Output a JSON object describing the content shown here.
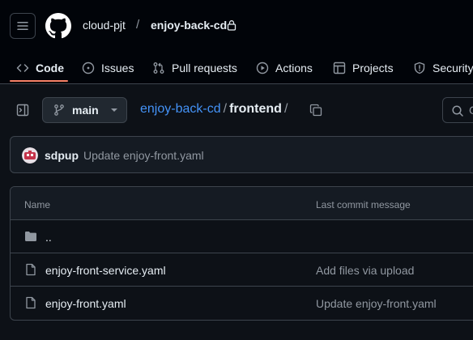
{
  "header": {
    "owner": "cloud-pjt",
    "separator": "/",
    "repo": "enjoy-back-cd"
  },
  "tabs": [
    {
      "label": "Code",
      "icon": "code-icon",
      "active": true
    },
    {
      "label": "Issues",
      "icon": "issue-opened-icon"
    },
    {
      "label": "Pull requests",
      "icon": "git-pull-request-icon"
    },
    {
      "label": "Actions",
      "icon": "play-icon"
    },
    {
      "label": "Projects",
      "icon": "table-icon"
    },
    {
      "label": "Security",
      "icon": "shield-icon"
    }
  ],
  "toolbar": {
    "branch": "main",
    "path_repo": "enjoy-back-cd",
    "path_sep": "/",
    "path_dir": "frontend",
    "path_trailing": "/"
  },
  "commit": {
    "user": "sdpup",
    "message": "Update enjoy-front.yaml"
  },
  "table": {
    "headers": {
      "name": "Name",
      "commit": "Last commit message"
    },
    "rows": [
      {
        "name": "..",
        "type": "folder",
        "message": ""
      },
      {
        "name": "enjoy-front-service.yaml",
        "type": "file",
        "message": "Add files via upload"
      },
      {
        "name": "enjoy-front.yaml",
        "type": "file",
        "message": "Update enjoy-front.yaml"
      }
    ]
  },
  "colors": {
    "background": "#0d1117",
    "header_bg": "#010409",
    "border": "#3d444d",
    "link": "#4493f8",
    "tab_underline": "#f78166",
    "muted_text": "#9198a1"
  }
}
